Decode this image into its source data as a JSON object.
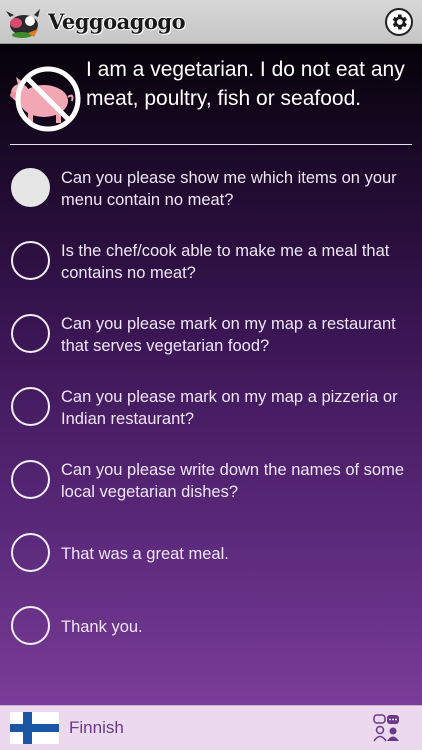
{
  "app": {
    "title": "Veggoagogo"
  },
  "header": {
    "statement": "I am a vegetarian. I do not eat any meat, poultry, fish or seafood."
  },
  "questions": [
    {
      "text": "Can you please show me which items on your menu contain no meat?",
      "selected": true
    },
    {
      "text": "Is the chef/cook able to make me a meal that contains no meat?",
      "selected": false
    },
    {
      "text": "Can you please mark on my map a restaurant that serves vegetarian food?",
      "selected": false
    },
    {
      "text": "Can you please mark on my map a pizzeria or Indian restaurant?",
      "selected": false
    },
    {
      "text": "Can you please write down the names of some local vegetarian dishes?",
      "selected": false
    },
    {
      "text": "That was a great meal.",
      "selected": false
    },
    {
      "text": "Thank you.",
      "selected": false
    }
  ],
  "footer": {
    "language": "Finnish"
  },
  "colors": {
    "accent": "#6a3a8a",
    "flag_blue": "#1a56a4",
    "no_sign_red": "#e0312f"
  },
  "icons": {
    "settings": "gear-icon",
    "header": "no-pig-icon",
    "footer_flag": "finland-flag-icon",
    "footer_action": "chat-people-icon"
  }
}
